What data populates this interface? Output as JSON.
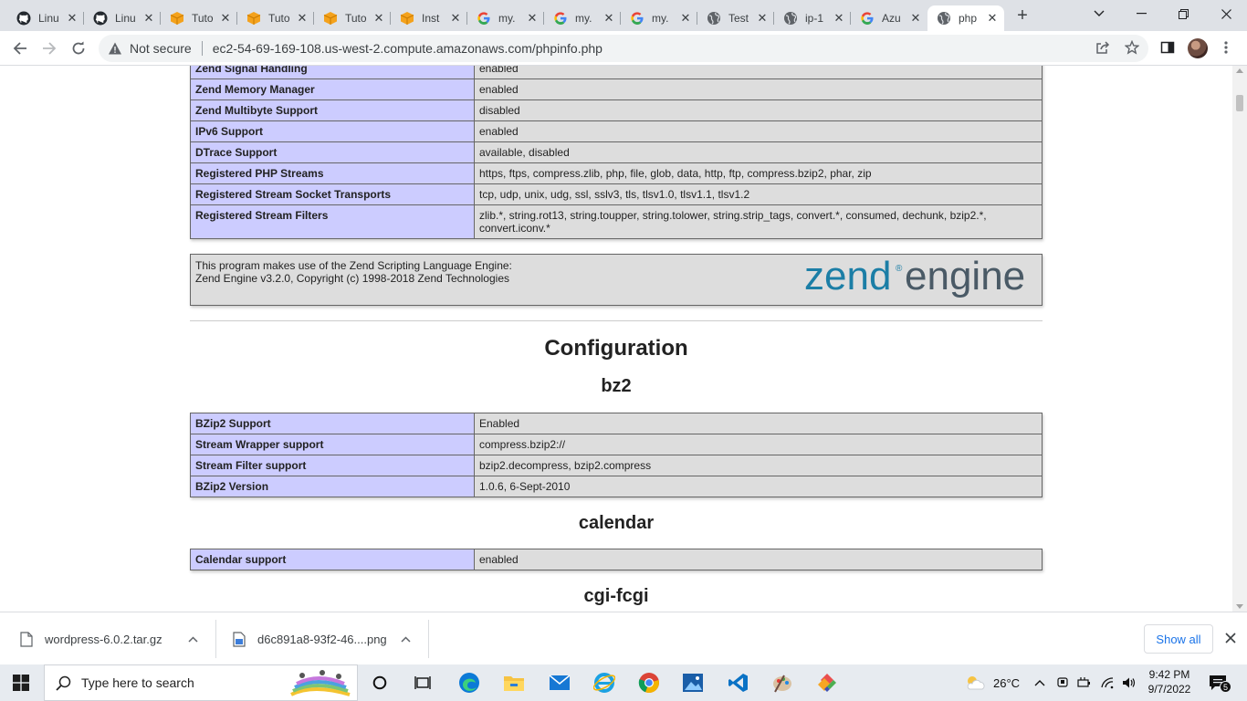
{
  "browser": {
    "tabs": [
      {
        "title": "Linu",
        "icon": "github-icon"
      },
      {
        "title": "Linu",
        "icon": "github-icon"
      },
      {
        "title": "Tuto",
        "icon": "box-icon"
      },
      {
        "title": "Tuto",
        "icon": "box-icon"
      },
      {
        "title": "Tuto",
        "icon": "box-icon"
      },
      {
        "title": "Inst",
        "icon": "box-icon"
      },
      {
        "title": "my.",
        "icon": "google-icon"
      },
      {
        "title": "my.",
        "icon": "google-icon"
      },
      {
        "title": "my.",
        "icon": "google-icon"
      },
      {
        "title": "Test",
        "icon": "globe-icon"
      },
      {
        "title": "ip-1",
        "icon": "globe-icon"
      },
      {
        "title": "Azu",
        "icon": "google-icon"
      },
      {
        "title": "php",
        "icon": "globe-icon"
      }
    ],
    "omnibox": {
      "security_label": "Not secure",
      "url": "ec2-54-69-169-108.us-west-2.compute.amazonaws.com/phpinfo.php"
    }
  },
  "page": {
    "engine_rows": [
      {
        "key": "Zend Signal Handling",
        "value": "enabled"
      },
      {
        "key": "Zend Memory Manager",
        "value": "enabled"
      },
      {
        "key": "Zend Multibyte Support",
        "value": "disabled"
      },
      {
        "key": "IPv6 Support",
        "value": "enabled"
      },
      {
        "key": "DTrace Support",
        "value": "available, disabled"
      },
      {
        "key": "Registered PHP Streams",
        "value": "https, ftps, compress.zlib, php, file, glob, data, http, ftp, compress.bzip2, phar, zip"
      },
      {
        "key": "Registered Stream Socket Transports",
        "value": "tcp, udp, unix, udg, ssl, sslv3, tls, tlsv1.0, tlsv1.1, tlsv1.2"
      },
      {
        "key": "Registered Stream Filters",
        "value": "zlib.*, string.rot13, string.toupper, string.tolower, string.strip_tags, convert.*, consumed, dechunk, bzip2.*, convert.iconv.*"
      }
    ],
    "zend_box": {
      "line1": "This program makes use of the Zend Scripting Language Engine:",
      "line2": "Zend Engine v3.2.0, Copyright (c) 1998-2018 Zend Technologies",
      "logo_word1": "zend",
      "logo_word2": "engine",
      "logo_mark": "®"
    },
    "configuration_heading": "Configuration",
    "sections": [
      {
        "title": "bz2",
        "rows": [
          {
            "key": "BZip2 Support",
            "value": "Enabled"
          },
          {
            "key": "Stream Wrapper support",
            "value": "compress.bzip2://"
          },
          {
            "key": "Stream Filter support",
            "value": "bzip2.decompress, bzip2.compress"
          },
          {
            "key": "BZip2 Version",
            "value": "1.0.6, 6-Sept-2010"
          }
        ]
      },
      {
        "title": "calendar",
        "rows": [
          {
            "key": "Calendar support",
            "value": "enabled"
          }
        ]
      },
      {
        "title": "cgi-fcgi",
        "rows": []
      }
    ]
  },
  "downloads": {
    "items": [
      {
        "name": "wordpress-6.0.2.tar.gz"
      },
      {
        "name": "d6c891a8-93f2-46....png"
      }
    ],
    "show_all": "Show all"
  },
  "taskbar": {
    "search_placeholder": "Type here to search",
    "weather": "26°C",
    "time": "9:42 PM",
    "date": "9/7/2022",
    "notification_count": "5"
  },
  "colors": {
    "key_cell": "#ccccff",
    "value_cell": "#dddddd",
    "zend_blue": "#1b7ea6",
    "zend_grey": "#4a5a66"
  }
}
